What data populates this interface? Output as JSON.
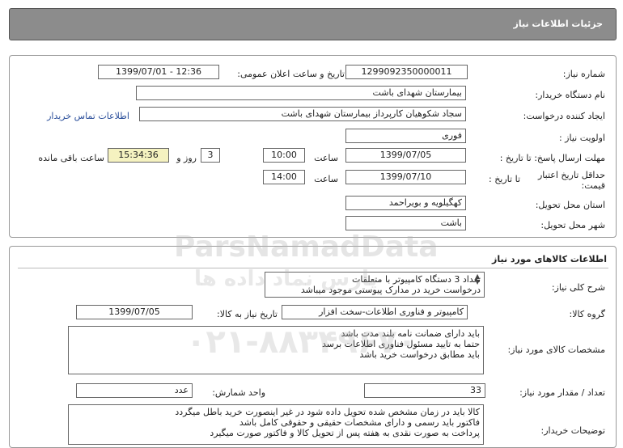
{
  "header": {
    "title": "جزئیات اطلاعات نیاز"
  },
  "watermark": {
    "brand": "ParsNamadData",
    "brand_fa": "پارس نماد داده ها",
    "phone": "۰۲۱-۸۸۳۴۹۶۷۰"
  },
  "info": {
    "need_number_label": "شماره نیاز:",
    "need_number": "1299092350000011",
    "announce_label": "تاریخ و ساعت اعلان عمومی:",
    "announce_value": "1399/07/01 - 12:36",
    "buyer_org_label": "نام دستگاه خریدار:",
    "buyer_org": "بیمارستان شهدای باشت",
    "requester_label": "ایجاد کننده درخواست:",
    "requester": "سجاد شکوهیان کارپرداز بیمارستان شهدای باشت",
    "contact_link": "اطلاعات تماس خریدار",
    "priority_label": "اولویت نیاز :",
    "priority": "فوری",
    "deadline_label": "مهلت ارسال پاسخ: تا تاریخ :",
    "deadline_date": "1399/07/05",
    "deadline_time_label": "ساعت",
    "deadline_time": "10:00",
    "days_value": "3",
    "days_label": "روز و",
    "remaining_time": "15:34:36",
    "remaining_label": "ساعت باقی مانده",
    "validity_label": "حداقل تاریخ اعتبار قیمت:",
    "validity_to_label": "تا تاریخ :",
    "validity_date": "1399/07/10",
    "validity_time_label": "ساعت",
    "validity_time": "14:00",
    "province_label": "استان محل تحویل:",
    "province": "کهگیلویه و بویراحمد",
    "city_label": "شهر محل تحویل:",
    "city": "باشت"
  },
  "goods": {
    "section_title": "اطلاعات کالاهای مورد نیاز",
    "description_label": "شرح کلی نیاز:",
    "description_lines": [
      "تعداد 3 دستگاه کامپیوتر با متعلقات",
      "درخواست خرید در مدارک پیوستی موجود میباشد"
    ],
    "group_label": "گروه کالا:",
    "group": "کامپیوتر و فناوری اطلاعات-سخت افزار",
    "need_date_label": "تاریخ نیاز به کالا:",
    "need_date": "1399/07/05",
    "specs_label": "مشخصات کالای مورد نیاز:",
    "specs_lines": [
      "باید دارای ضمانت نامه بلند مدت باشد",
      "حتما به تایید مسئول فناوری اطلاعات برسد",
      "باید مطابق درخواست خرید باشد"
    ],
    "quantity_label": "تعداد / مقدار مورد نیاز:",
    "quantity": "33",
    "unit_label": "واحد شمارش:",
    "unit": "عدد",
    "buyer_notes_label": "توضیحات خریدار:",
    "buyer_notes_lines": [
      "کالا باید در زمان مشخص شده تحویل داده شود در غیر اینصورت خرید باطل میگردد",
      "فاکتور باید رسمی و دارای مشخصات حقیقی و حقوقی کامل باشد",
      "پرداخت به صورت نقدی به هفته پس از تحویل کالا و فاکتور صورت میگیرد"
    ]
  }
}
